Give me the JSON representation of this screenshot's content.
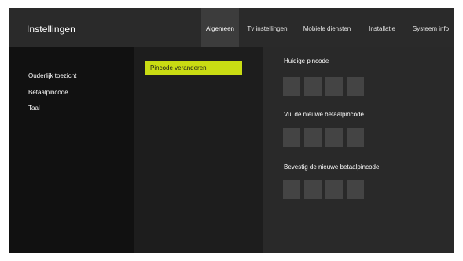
{
  "app": {
    "title": "Instellingen"
  },
  "tabs": [
    {
      "label": "Algemeen",
      "active": true
    },
    {
      "label": "Tv instellingen",
      "active": false
    },
    {
      "label": "Mobiele diensten",
      "active": false
    },
    {
      "label": "Installatie",
      "active": false
    },
    {
      "label": "Systeem info",
      "active": false
    }
  ],
  "sidebar": {
    "items": [
      {
        "label": "Ouderlijk toezicht"
      },
      {
        "label": "Betaalpincode"
      },
      {
        "label": "Taal"
      }
    ]
  },
  "actions": {
    "change_pin": "Pincode veranderen"
  },
  "form": {
    "current_pin_label": "Huidige pincode",
    "new_pin_label": "Vul de nieuwe betaalpincode",
    "confirm_pin_label": "Bevestig de nieuwe betaalpincode"
  },
  "colors": {
    "accent": "#c9dc13",
    "background": "#111111",
    "topbar": "#2a2a2a"
  }
}
